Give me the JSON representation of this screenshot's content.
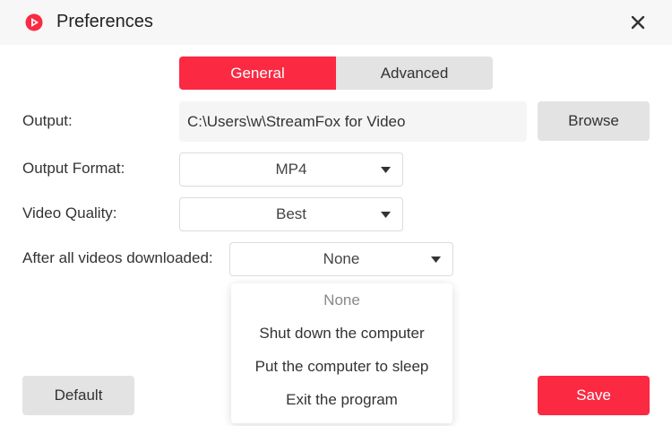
{
  "window": {
    "title": "Preferences",
    "accent_color": "#fb2942"
  },
  "tabs": [
    {
      "label": "General",
      "active": true
    },
    {
      "label": "Advanced",
      "active": false
    }
  ],
  "output": {
    "label": "Output:",
    "path": "C:\\Users\\w\\StreamFox for Video",
    "browse_label": "Browse"
  },
  "output_format": {
    "label": "Output Format:",
    "value": "MP4"
  },
  "video_quality": {
    "label": "Video Quality:",
    "value": "Best"
  },
  "after_download": {
    "label": "After all videos downloaded:",
    "value": "None",
    "options": [
      "None",
      "Shut down the computer",
      "Put the computer to sleep",
      "Exit the program"
    ]
  },
  "footer": {
    "default_label": "Default",
    "save_label": "Save"
  }
}
